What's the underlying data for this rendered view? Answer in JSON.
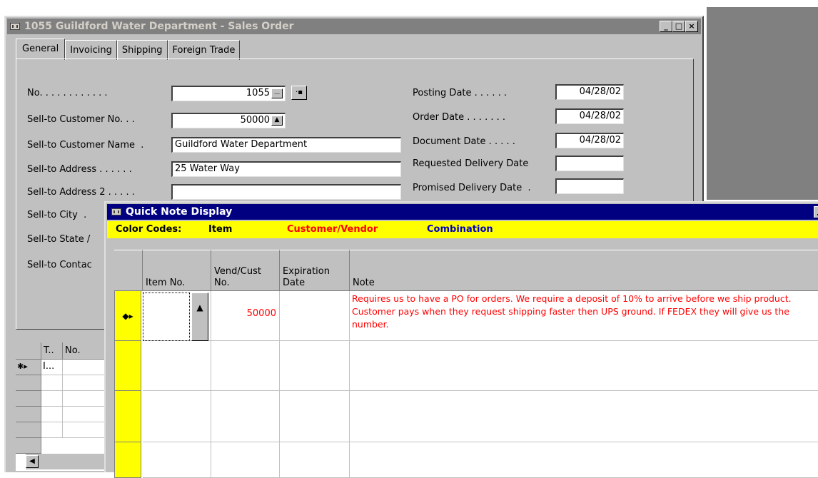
{
  "sales_order": {
    "title": "1055 Guildford Water Department - Sales Order",
    "window_controls": [
      "_",
      "□",
      "×"
    ],
    "tabs": [
      "General",
      "Invoicing",
      "Shipping",
      "Foreign Trade"
    ],
    "fields_left": [
      {
        "label": "No. . . . . . . . . . . .",
        "value": "1055"
      },
      {
        "label": "Sell-to Customer No. . .",
        "value": "50000"
      },
      {
        "label": "Sell-to Customer Name  .",
        "value": "Guildford Water Department"
      },
      {
        "label": "Sell-to Address . . . . . .",
        "value": "25 Water Way"
      },
      {
        "label": "Sell-to Address 2 . . . . .",
        "value": ""
      },
      {
        "label": "Sell-to City  .",
        "value": ""
      },
      {
        "label": "Sell-to State /",
        "value": ""
      },
      {
        "label": "Sell-to Contac",
        "value": ""
      }
    ],
    "fields_right": [
      {
        "label": "Posting Date . . . . . .",
        "value": "04/28/02"
      },
      {
        "label": "Order Date . . . . . . .",
        "value": "04/28/02"
      },
      {
        "label": "Document Date . . . . .",
        "value": "04/28/02"
      },
      {
        "label": "Requested Delivery Date",
        "value": ""
      },
      {
        "label": "Promised Delivery Date  .",
        "value": ""
      }
    ],
    "lines": {
      "headers": [
        "T..",
        "No."
      ],
      "first_row_marker": "✱▸",
      "first_row_type": "I..."
    }
  },
  "quick_note": {
    "title": "Quick Note Display",
    "legend": {
      "label": "Color Codes:",
      "item": "Item",
      "customer_vendor": "Customer/Vendor",
      "combination": "Combination"
    },
    "colors": {
      "item": "#000000",
      "customer_vendor": "#ff0000",
      "combination": "#0000c0",
      "highlight": "#ffff00"
    },
    "columns": [
      "Item No.",
      "Vend/Cust No.",
      "Expiration Date",
      "Note"
    ],
    "rows": [
      {
        "marker": "◆▸",
        "item_no": "",
        "vend_cust_no": "50000",
        "expiration_date": "",
        "note": "Requires us to have a PO for orders.  We require a deposit of 10% to arrive before we ship product.  Customer pays when they request shipping faster then UPS ground.  If FEDEX they will give us the number."
      }
    ]
  }
}
